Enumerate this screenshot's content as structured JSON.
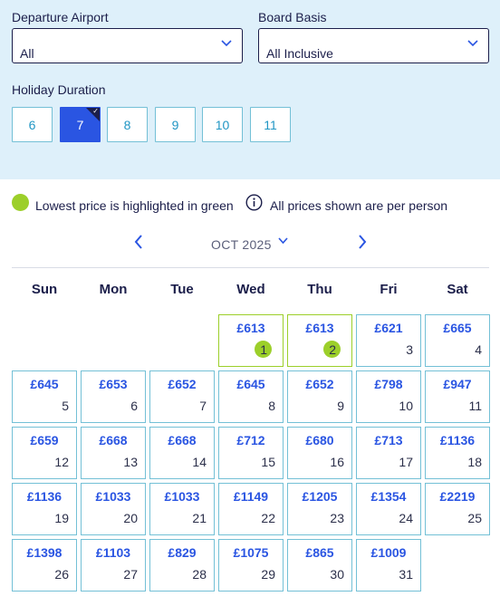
{
  "filters": {
    "departure_label": "Departure Airport",
    "departure_value": "All",
    "board_label": "Board Basis",
    "board_value": "All Inclusive",
    "duration_label": "Holiday Duration",
    "durations": [
      "6",
      "7",
      "8",
      "9",
      "10",
      "11"
    ],
    "selected_duration": "7",
    "selected_tick": "✓"
  },
  "legend": {
    "lowest_text": "Lowest price is highlighted in green",
    "info_text": "All prices shown are per person"
  },
  "calendar": {
    "month": "OCT 2025",
    "weekdays": [
      "Sun",
      "Mon",
      "Tue",
      "Wed",
      "Thu",
      "Fri",
      "Sat"
    ],
    "days": [
      {
        "day": "1",
        "price": "£613",
        "lowest": true
      },
      {
        "day": "2",
        "price": "£613",
        "lowest": true
      },
      {
        "day": "3",
        "price": "£621",
        "lowest": false
      },
      {
        "day": "4",
        "price": "£665",
        "lowest": false
      },
      {
        "day": "5",
        "price": "£645",
        "lowest": false
      },
      {
        "day": "6",
        "price": "£653",
        "lowest": false
      },
      {
        "day": "7",
        "price": "£652",
        "lowest": false
      },
      {
        "day": "8",
        "price": "£645",
        "lowest": false
      },
      {
        "day": "9",
        "price": "£652",
        "lowest": false
      },
      {
        "day": "10",
        "price": "£798",
        "lowest": false
      },
      {
        "day": "11",
        "price": "£947",
        "lowest": false
      },
      {
        "day": "12",
        "price": "£659",
        "lowest": false
      },
      {
        "day": "13",
        "price": "£668",
        "lowest": false
      },
      {
        "day": "14",
        "price": "£668",
        "lowest": false
      },
      {
        "day": "15",
        "price": "£712",
        "lowest": false
      },
      {
        "day": "16",
        "price": "£680",
        "lowest": false
      },
      {
        "day": "17",
        "price": "£713",
        "lowest": false
      },
      {
        "day": "18",
        "price": "£1136",
        "lowest": false
      },
      {
        "day": "19",
        "price": "£1136",
        "lowest": false
      },
      {
        "day": "20",
        "price": "£1033",
        "lowest": false
      },
      {
        "day": "21",
        "price": "£1033",
        "lowest": false
      },
      {
        "day": "22",
        "price": "£1149",
        "lowest": false
      },
      {
        "day": "23",
        "price": "£1205",
        "lowest": false
      },
      {
        "day": "24",
        "price": "£1354",
        "lowest": false
      },
      {
        "day": "25",
        "price": "£2219",
        "lowest": false
      },
      {
        "day": "26",
        "price": "£1398",
        "lowest": false
      },
      {
        "day": "27",
        "price": "£1103",
        "lowest": false
      },
      {
        "day": "28",
        "price": "£829",
        "lowest": false
      },
      {
        "day": "29",
        "price": "£1075",
        "lowest": false
      },
      {
        "day": "30",
        "price": "£865",
        "lowest": false
      },
      {
        "day": "31",
        "price": "£1009",
        "lowest": false
      }
    ]
  },
  "colors": {
    "accent_blue": "#2a55e2",
    "lowest_green": "#9ccf2a",
    "cell_border": "#73c0d6",
    "filter_background": "#def0fa",
    "text_navy": "#1b1e4a"
  }
}
